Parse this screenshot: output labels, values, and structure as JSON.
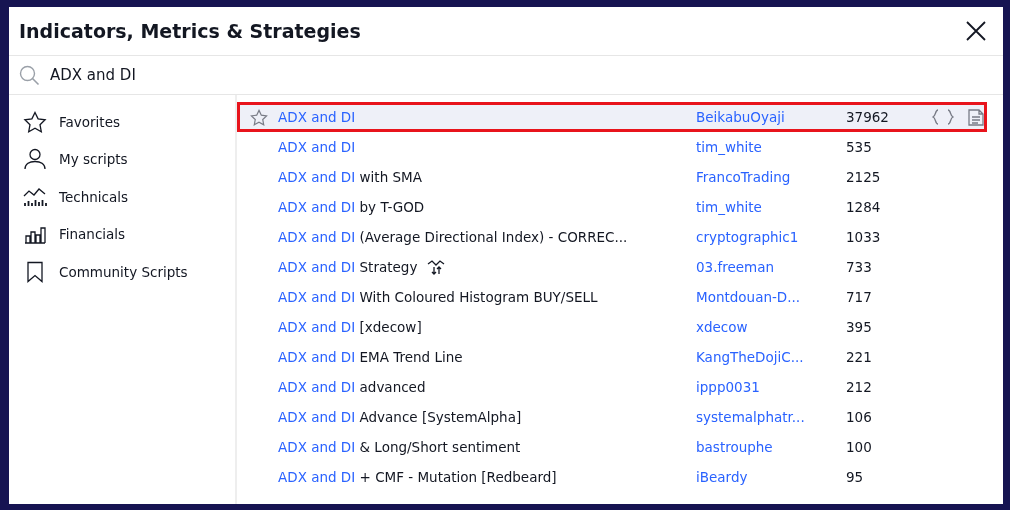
{
  "dialog": {
    "title": "Indicators, Metrics & Strategies"
  },
  "search": {
    "value": "ADX and DI"
  },
  "sidebar": {
    "items": [
      {
        "label": "Favorites"
      },
      {
        "label": "My scripts"
      },
      {
        "label": "Technicals"
      },
      {
        "label": "Financials"
      },
      {
        "label": "Community Scripts"
      }
    ]
  },
  "results": [
    {
      "match": "ADX and DI",
      "author": "BeikabuOyaji",
      "count": "37962",
      "selected": true,
      "kind": "indicator"
    },
    {
      "match": "ADX and DI",
      "author": "tim_white",
      "count": "535",
      "selected": false,
      "kind": "indicator"
    },
    {
      "match": "ADX and DI",
      "rest": "with SMA",
      "author": "FrancoTrading",
      "count": "2125",
      "selected": false,
      "kind": "indicator"
    },
    {
      "match": "ADX and DI",
      "rest": "by T-GOD",
      "author": "tim_white",
      "count": "1284",
      "selected": false,
      "kind": "indicator"
    },
    {
      "match": "ADX and DI",
      "rest": "(Average Directional Index) - CORREC...",
      "author": "cryptographic1",
      "count": "1033",
      "selected": false,
      "kind": "indicator"
    },
    {
      "match": "ADX and DI",
      "rest": "Strategy",
      "author": "03.freeman",
      "count": "733",
      "selected": false,
      "kind": "strategy"
    },
    {
      "match": "ADX and DI",
      "rest": "With Coloured Histogram BUY/SELL",
      "author": "Montdouan-D...",
      "count": "717",
      "selected": false,
      "kind": "indicator"
    },
    {
      "match": "ADX and DI",
      "rest": "[xdecow]",
      "author": "xdecow",
      "count": "395",
      "selected": false,
      "kind": "indicator"
    },
    {
      "match": "ADX and DI",
      "rest": "EMA Trend Line",
      "author": "KangTheDojiC...",
      "count": "221",
      "selected": false,
      "kind": "indicator"
    },
    {
      "match": "ADX and DI",
      "rest": "advanced",
      "author": "ippp0031",
      "count": "212",
      "selected": false,
      "kind": "indicator"
    },
    {
      "match": "ADX and DI",
      "rest": "Advance [SystemAlpha]",
      "author": "systemalphatr...",
      "count": "106",
      "selected": false,
      "kind": "indicator"
    },
    {
      "match": "ADX and DI",
      "rest": "& Long/Short sentiment",
      "author": "bastrouphe",
      "count": "100",
      "selected": false,
      "kind": "indicator"
    },
    {
      "match": "ADX and DI",
      "rest": "+ CMF - Mutation [Redbeard]",
      "author": "iBeardy",
      "count": "95",
      "selected": false,
      "kind": "indicator"
    }
  ]
}
